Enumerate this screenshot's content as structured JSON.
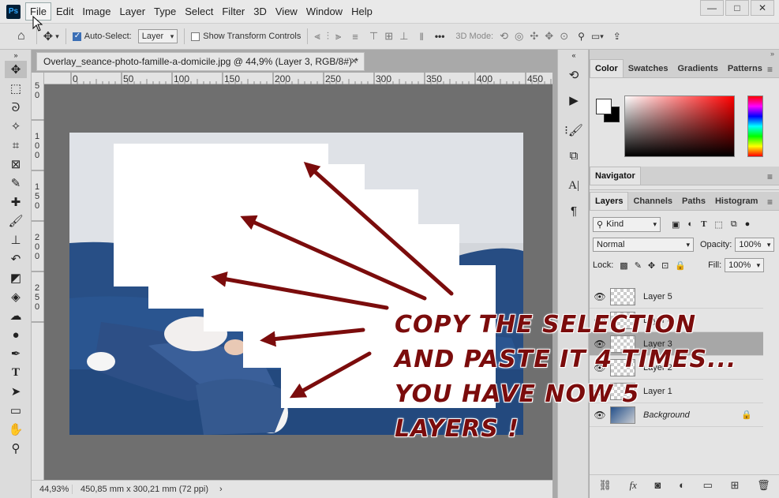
{
  "app": {
    "logo": "Ps"
  },
  "menu": [
    "File",
    "Edit",
    "Image",
    "Layer",
    "Type",
    "Select",
    "Filter",
    "3D",
    "View",
    "Window",
    "Help"
  ],
  "window_controls": {
    "minimize": "—",
    "maximize": "□",
    "close": "✕"
  },
  "options": {
    "auto_select_label": "Auto-Select:",
    "auto_select_value": "Layer",
    "show_transform_label": "Show Transform Controls",
    "mode_3d_label": "3D Mode:"
  },
  "document": {
    "tab_title": "Overlay_seance-photo-famille-a-domicile.jpg @ 44,9% (Layer 3, RGB/8#) *",
    "zoom": "44,93%",
    "doc_info": "450,85 mm x 300,21 mm (72 ppi)"
  },
  "ruler": {
    "h_ticks": [
      "0",
      "50",
      "100",
      "150",
      "200",
      "250",
      "300",
      "350",
      "400",
      "450"
    ],
    "v_ticks": [
      "50",
      "100",
      "150",
      "200",
      "250"
    ]
  },
  "color_panel": {
    "tabs": [
      "Color",
      "Swatches",
      "Gradients",
      "Patterns"
    ]
  },
  "navigator": {
    "title": "Navigator"
  },
  "layers_panel": {
    "tabs": [
      "Layers",
      "Channels",
      "Paths",
      "Histogram"
    ],
    "filter_label": "Kind",
    "blend_mode": "Normal",
    "opacity_label": "Opacity:",
    "opacity_value": "100%",
    "lock_label": "Lock:",
    "fill_label": "Fill:",
    "fill_value": "100%",
    "layers": [
      {
        "name": "Layer 5",
        "selected": false
      },
      {
        "name": "Layer 4",
        "selected": false
      },
      {
        "name": "Layer 3",
        "selected": true
      },
      {
        "name": "Layer 2",
        "selected": false
      },
      {
        "name": "Layer 1",
        "selected": false
      },
      {
        "name": "Background",
        "selected": false
      }
    ]
  },
  "annotation": {
    "line1": "COPY THE SELECTION",
    "line2": "AND PASTE IT 4 TIMES...",
    "line3": "YOU HAVE NOW 5 LAYERS !"
  },
  "colors": {
    "annotation": "#7b0c0c",
    "canvas_bg": "#6f6f6f",
    "sofa": "#264f85"
  }
}
